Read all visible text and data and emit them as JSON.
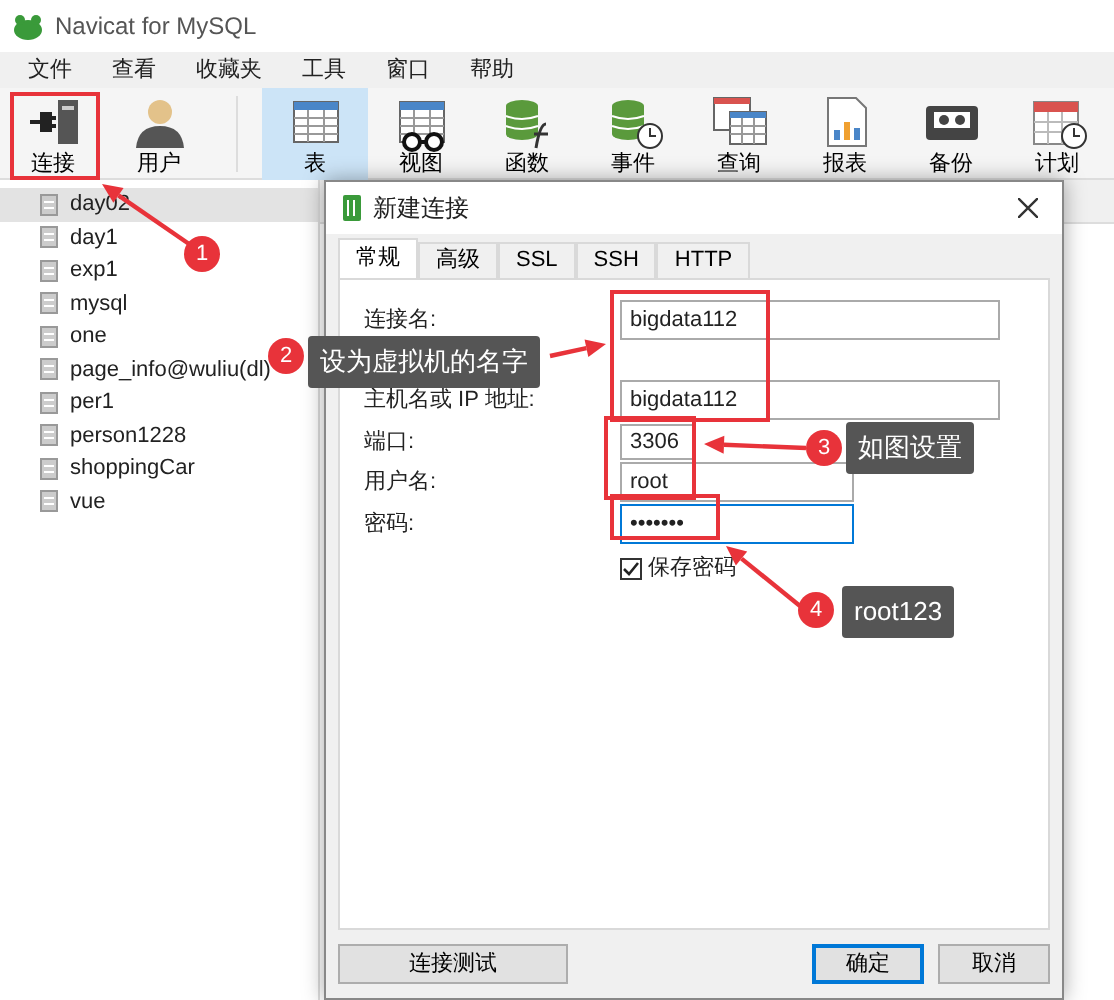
{
  "window": {
    "title": "Navicat for MySQL"
  },
  "menu": [
    "文件",
    "查看",
    "收藏夹",
    "工具",
    "窗口",
    "帮助"
  ],
  "toolbar": [
    {
      "label": "连接",
      "kind": "connection",
      "selected": false
    },
    {
      "label": "用户",
      "kind": "user",
      "selected": false
    },
    {
      "label": "表",
      "kind": "table",
      "selected": true
    },
    {
      "label": "视图",
      "kind": "view",
      "selected": false
    },
    {
      "label": "函数",
      "kind": "function",
      "selected": false
    },
    {
      "label": "事件",
      "kind": "event",
      "selected": false
    },
    {
      "label": "查询",
      "kind": "query",
      "selected": false
    },
    {
      "label": "报表",
      "kind": "report",
      "selected": false
    },
    {
      "label": "备份",
      "kind": "backup",
      "selected": false
    },
    {
      "label": "计划",
      "kind": "schedule",
      "selected": false
    }
  ],
  "connections": [
    {
      "name": "day02",
      "selected": true
    },
    {
      "name": "day1",
      "selected": false
    },
    {
      "name": "exp1",
      "selected": false
    },
    {
      "name": "mysql",
      "selected": false
    },
    {
      "name": "one",
      "selected": false
    },
    {
      "name": "page_info@wuliu(dl)",
      "selected": false
    },
    {
      "name": "per1",
      "selected": false
    },
    {
      "name": "person1228",
      "selected": false
    },
    {
      "name": "shoppingCar",
      "selected": false
    },
    {
      "name": "vue",
      "selected": false
    }
  ],
  "dialog": {
    "title": "新建连接",
    "tabs": [
      {
        "label": "常规",
        "selected": true
      },
      {
        "label": "高级",
        "selected": false
      },
      {
        "label": "SSL",
        "selected": false
      },
      {
        "label": "SSH",
        "selected": false
      },
      {
        "label": "HTTP",
        "selected": false
      }
    ],
    "fields": [
      {
        "label": "连接名:",
        "value": "bigdata112",
        "kind": "wide",
        "focused": false
      },
      {
        "label": "主机名或 IP 地址:",
        "value": "bigdata112",
        "kind": "wide",
        "focused": false
      },
      {
        "label": "端口:",
        "value": "3306",
        "kind": "narrow",
        "focused": false
      },
      {
        "label": "用户名:",
        "value": "root",
        "kind": "medium",
        "focused": false
      },
      {
        "label": "密码:",
        "value": "•••••••",
        "kind": "medium",
        "focused": true
      }
    ],
    "save_password": {
      "label": "保存密码",
      "checked": true
    },
    "buttons": [
      {
        "label": "连接测试",
        "default": false
      },
      {
        "label": "确定",
        "default": true
      },
      {
        "label": "取消",
        "default": false
      }
    ]
  },
  "annotations": [
    {
      "number": "1"
    },
    {
      "number": "2",
      "text": "设为虚拟机的名字"
    },
    {
      "number": "3",
      "text": "如图设置"
    },
    {
      "number": "4",
      "text": "root123"
    }
  ]
}
